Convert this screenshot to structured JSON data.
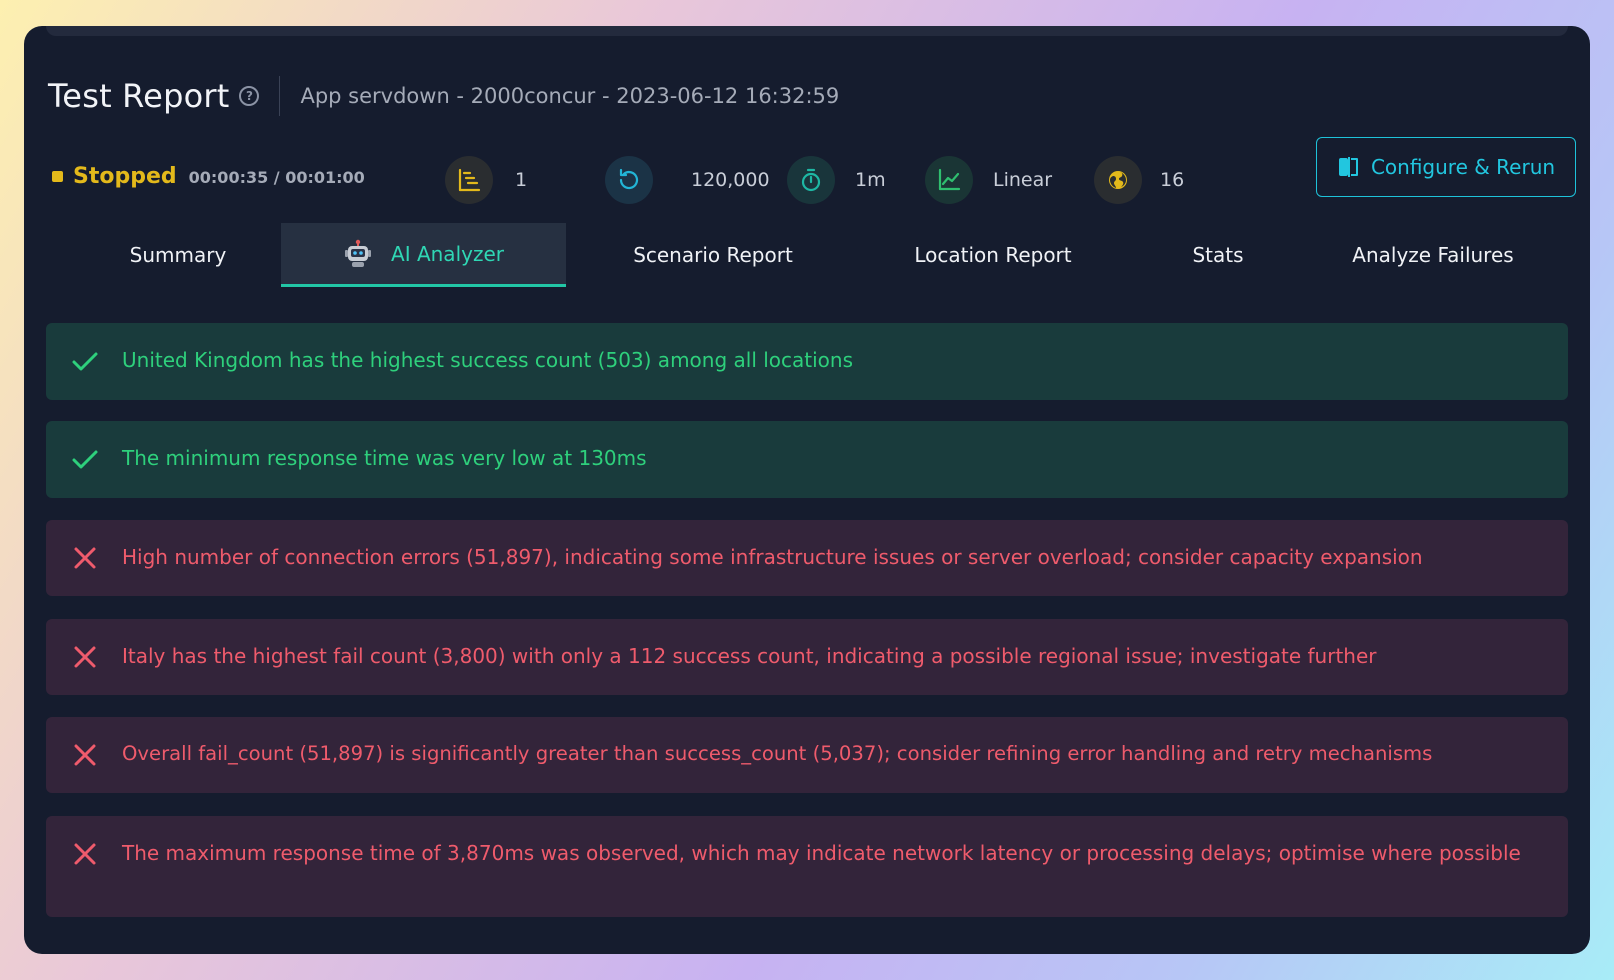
{
  "header": {
    "title": "Test Report",
    "subtitle": "App servdown - 2000concur - 2023-06-12 16:32:59"
  },
  "status": {
    "label": "Stopped",
    "time": "00:00:35 / 00:01:00"
  },
  "metrics": [
    {
      "icon": "scenarios-icon",
      "value": "1",
      "color": "#e3b91b"
    },
    {
      "icon": "iterations-icon",
      "value": "120,000",
      "color": "#22b5d6"
    },
    {
      "icon": "duration-icon",
      "value": "1m",
      "color": "#1eb7a4"
    },
    {
      "icon": "ramp-chart-icon",
      "value": "Linear",
      "color": "#2fbe6f"
    },
    {
      "icon": "globe-icon",
      "value": "16",
      "color": "#e3b91b"
    }
  ],
  "configure_button": {
    "label": "Configure & Rerun"
  },
  "tabs": [
    {
      "label": "Summary"
    },
    {
      "label": "AI Analyzer",
      "active": true
    },
    {
      "label": "Scenario Report"
    },
    {
      "label": "Location Report"
    },
    {
      "label": "Stats"
    },
    {
      "label": "Analyze Failures"
    }
  ],
  "insights": [
    {
      "type": "success",
      "text": "United Kingdom has the highest success count (503) among all locations"
    },
    {
      "type": "success",
      "text": "The minimum response time was very low at 130ms"
    },
    {
      "type": "failure",
      "text": "High number of connection errors (51,897), indicating some infrastructure issues or server overload; consider capacity expansion"
    },
    {
      "type": "failure",
      "text": "Italy has the highest fail count (3,800) with only a 112 success count, indicating a possible regional issue; investigate further"
    },
    {
      "type": "failure",
      "text": "Overall fail_count (51,897) is significantly greater than success_count (5,037); consider refining error handling and retry mechanisms"
    },
    {
      "type": "failure",
      "text": "The maximum response time of 3,870ms was observed, which may indicate network latency or processing delays; optimise where possible"
    }
  ],
  "colors": {
    "background": "#151c2e",
    "accent": "#22c6df",
    "success": "#2ed07c",
    "failure": "#ef5b6c",
    "warning": "#e3b91b"
  }
}
